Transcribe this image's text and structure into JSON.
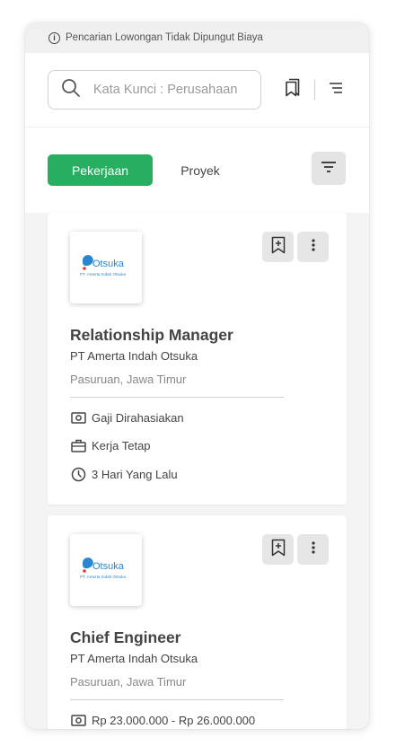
{
  "notice": {
    "text": "Pencarian Lowongan Tidak Dipungut Biaya"
  },
  "search": {
    "placeholder": "Kata Kunci : Perusahaan"
  },
  "tabs": [
    {
      "label": "Pekerjaan",
      "active": true
    },
    {
      "label": "Proyek",
      "active": false
    }
  ],
  "colors": {
    "accent": "#27ae60"
  },
  "jobs": [
    {
      "logo_text": "Otsuka",
      "logo_subtext": "PT. Amerta Indah Otsuka",
      "title": "Relationship Manager",
      "company": "PT Amerta Indah Otsuka",
      "location": "Pasuruan, Jawa Timur",
      "salary": "Gaji Dirahasiakan",
      "type": "Kerja Tetap",
      "posted": "3 Hari Yang Lalu"
    },
    {
      "logo_text": "Otsuka",
      "logo_subtext": "PT. Amerta Indah Otsuka",
      "title": "Chief Engineer",
      "company": "PT Amerta Indah Otsuka",
      "location": "Pasuruan, Jawa Timur",
      "salary": "Rp 23.000.000 - Rp 26.000.000"
    }
  ]
}
